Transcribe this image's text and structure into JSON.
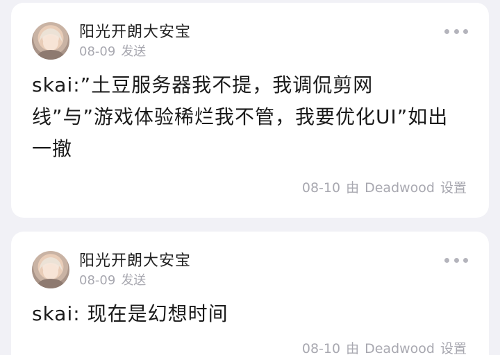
{
  "posts": [
    {
      "author": "阳光开朗大安宝",
      "date": "08-09",
      "action": "发送",
      "content": "skai:”土豆服务器我不提，我调侃剪网线”与”游戏体验稀烂我不管，我要优化UI”如出一撤",
      "footer_date": "08-10",
      "footer_by": "由",
      "footer_user": "Deadwood",
      "footer_action": "设置"
    },
    {
      "author": "阳光开朗大安宝",
      "date": "08-09",
      "action": "发送",
      "content": "skai: 现在是幻想时间",
      "footer_date": "08-10",
      "footer_by": "由",
      "footer_user": "Deadwood",
      "footer_action": "设置"
    }
  ],
  "icons": {
    "more": "more-horizontal-icon",
    "avatar": "avatar-image"
  },
  "colors": {
    "background": "#f1f1f6",
    "card": "#ffffff",
    "meta_text": "#a8a8b0",
    "main_text": "#1a1a1a"
  }
}
